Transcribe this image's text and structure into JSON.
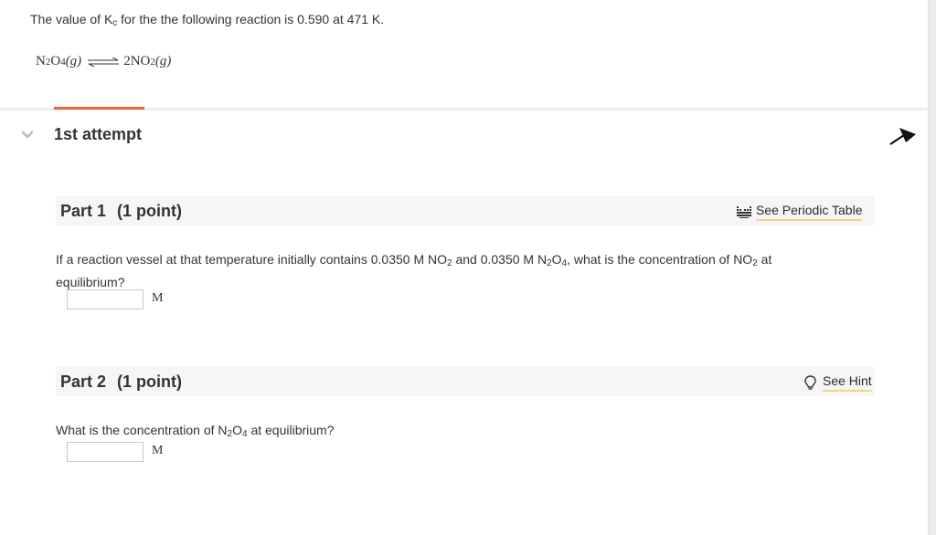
{
  "intro": {
    "prefix": "The value of K",
    "k_sub": "c",
    "suffix": " for the the following reaction is 0.590 at  471 K."
  },
  "equation": {
    "reactant": "N",
    "reactant_sub1": "2",
    "reactant_mid": "O",
    "reactant_sub2": "4",
    "reactant_phase": "(g)",
    "product_coeff": "2NO",
    "product_sub": "2",
    "product_phase": "(g)"
  },
  "attempt": {
    "title": "1st attempt",
    "tab_color": "#e8643c"
  },
  "part1": {
    "label": "Part 1",
    "points": "(1 point)",
    "link": "See Periodic Table",
    "q_a": "If a reaction vessel at that temperature initially contains 0.0350  M NO",
    "q_sub1": "2",
    "q_b": " and 0.0350  M N",
    "q_sub2": "2",
    "q_c": "O",
    "q_sub3": "4",
    "q_d": ", what is the concentration of NO",
    "q_sub4": "2",
    "q_e": " at equilibrium?",
    "input_value": "",
    "unit": "M"
  },
  "part2": {
    "label": "Part 2",
    "points": "(1 point)",
    "link": "See Hint",
    "q_a": "What is the concentration of N",
    "q_sub1": "2",
    "q_b": "O",
    "q_sub2": "4",
    "q_c": " at equilibrium?",
    "input_value": "",
    "unit": "M"
  },
  "icons": {
    "chevron": "chevron-down-icon",
    "pin": "pin-arrow-icon",
    "periodic": "periodic-table-icon",
    "hint": "lightbulb-icon"
  },
  "colors": {
    "accent": "#e8643c",
    "link_underline": "#f2d48a",
    "header_bg": "#f6f6f6"
  }
}
